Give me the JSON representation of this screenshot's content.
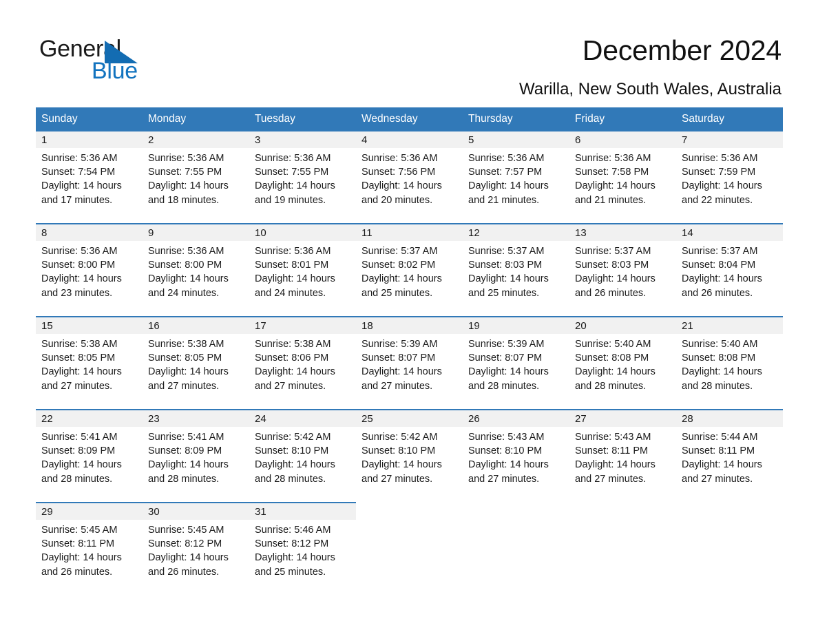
{
  "brand": {
    "word_one": "General",
    "word_two": "Blue",
    "triangle_icon": "triangle-icon",
    "accent_color": "#1273bf",
    "header_color": "#3179b8"
  },
  "header": {
    "title": "December 2024",
    "location": "Warilla, New South Wales, Australia"
  },
  "calendar": {
    "weekdays": [
      "Sunday",
      "Monday",
      "Tuesday",
      "Wednesday",
      "Thursday",
      "Friday",
      "Saturday"
    ],
    "weeks": [
      [
        {
          "day": "1",
          "sunrise": "Sunrise: 5:36 AM",
          "sunset": "Sunset: 7:54 PM",
          "daylight_1": "Daylight: 14 hours",
          "daylight_2": "and 17 minutes."
        },
        {
          "day": "2",
          "sunrise": "Sunrise: 5:36 AM",
          "sunset": "Sunset: 7:55 PM",
          "daylight_1": "Daylight: 14 hours",
          "daylight_2": "and 18 minutes."
        },
        {
          "day": "3",
          "sunrise": "Sunrise: 5:36 AM",
          "sunset": "Sunset: 7:55 PM",
          "daylight_1": "Daylight: 14 hours",
          "daylight_2": "and 19 minutes."
        },
        {
          "day": "4",
          "sunrise": "Sunrise: 5:36 AM",
          "sunset": "Sunset: 7:56 PM",
          "daylight_1": "Daylight: 14 hours",
          "daylight_2": "and 20 minutes."
        },
        {
          "day": "5",
          "sunrise": "Sunrise: 5:36 AM",
          "sunset": "Sunset: 7:57 PM",
          "daylight_1": "Daylight: 14 hours",
          "daylight_2": "and 21 minutes."
        },
        {
          "day": "6",
          "sunrise": "Sunrise: 5:36 AM",
          "sunset": "Sunset: 7:58 PM",
          "daylight_1": "Daylight: 14 hours",
          "daylight_2": "and 21 minutes."
        },
        {
          "day": "7",
          "sunrise": "Sunrise: 5:36 AM",
          "sunset": "Sunset: 7:59 PM",
          "daylight_1": "Daylight: 14 hours",
          "daylight_2": "and 22 minutes."
        }
      ],
      [
        {
          "day": "8",
          "sunrise": "Sunrise: 5:36 AM",
          "sunset": "Sunset: 8:00 PM",
          "daylight_1": "Daylight: 14 hours",
          "daylight_2": "and 23 minutes."
        },
        {
          "day": "9",
          "sunrise": "Sunrise: 5:36 AM",
          "sunset": "Sunset: 8:00 PM",
          "daylight_1": "Daylight: 14 hours",
          "daylight_2": "and 24 minutes."
        },
        {
          "day": "10",
          "sunrise": "Sunrise: 5:36 AM",
          "sunset": "Sunset: 8:01 PM",
          "daylight_1": "Daylight: 14 hours",
          "daylight_2": "and 24 minutes."
        },
        {
          "day": "11",
          "sunrise": "Sunrise: 5:37 AM",
          "sunset": "Sunset: 8:02 PM",
          "daylight_1": "Daylight: 14 hours",
          "daylight_2": "and 25 minutes."
        },
        {
          "day": "12",
          "sunrise": "Sunrise: 5:37 AM",
          "sunset": "Sunset: 8:03 PM",
          "daylight_1": "Daylight: 14 hours",
          "daylight_2": "and 25 minutes."
        },
        {
          "day": "13",
          "sunrise": "Sunrise: 5:37 AM",
          "sunset": "Sunset: 8:03 PM",
          "daylight_1": "Daylight: 14 hours",
          "daylight_2": "and 26 minutes."
        },
        {
          "day": "14",
          "sunrise": "Sunrise: 5:37 AM",
          "sunset": "Sunset: 8:04 PM",
          "daylight_1": "Daylight: 14 hours",
          "daylight_2": "and 26 minutes."
        }
      ],
      [
        {
          "day": "15",
          "sunrise": "Sunrise: 5:38 AM",
          "sunset": "Sunset: 8:05 PM",
          "daylight_1": "Daylight: 14 hours",
          "daylight_2": "and 27 minutes."
        },
        {
          "day": "16",
          "sunrise": "Sunrise: 5:38 AM",
          "sunset": "Sunset: 8:05 PM",
          "daylight_1": "Daylight: 14 hours",
          "daylight_2": "and 27 minutes."
        },
        {
          "day": "17",
          "sunrise": "Sunrise: 5:38 AM",
          "sunset": "Sunset: 8:06 PM",
          "daylight_1": "Daylight: 14 hours",
          "daylight_2": "and 27 minutes."
        },
        {
          "day": "18",
          "sunrise": "Sunrise: 5:39 AM",
          "sunset": "Sunset: 8:07 PM",
          "daylight_1": "Daylight: 14 hours",
          "daylight_2": "and 27 minutes."
        },
        {
          "day": "19",
          "sunrise": "Sunrise: 5:39 AM",
          "sunset": "Sunset: 8:07 PM",
          "daylight_1": "Daylight: 14 hours",
          "daylight_2": "and 28 minutes."
        },
        {
          "day": "20",
          "sunrise": "Sunrise: 5:40 AM",
          "sunset": "Sunset: 8:08 PM",
          "daylight_1": "Daylight: 14 hours",
          "daylight_2": "and 28 minutes."
        },
        {
          "day": "21",
          "sunrise": "Sunrise: 5:40 AM",
          "sunset": "Sunset: 8:08 PM",
          "daylight_1": "Daylight: 14 hours",
          "daylight_2": "and 28 minutes."
        }
      ],
      [
        {
          "day": "22",
          "sunrise": "Sunrise: 5:41 AM",
          "sunset": "Sunset: 8:09 PM",
          "daylight_1": "Daylight: 14 hours",
          "daylight_2": "and 28 minutes."
        },
        {
          "day": "23",
          "sunrise": "Sunrise: 5:41 AM",
          "sunset": "Sunset: 8:09 PM",
          "daylight_1": "Daylight: 14 hours",
          "daylight_2": "and 28 minutes."
        },
        {
          "day": "24",
          "sunrise": "Sunrise: 5:42 AM",
          "sunset": "Sunset: 8:10 PM",
          "daylight_1": "Daylight: 14 hours",
          "daylight_2": "and 28 minutes."
        },
        {
          "day": "25",
          "sunrise": "Sunrise: 5:42 AM",
          "sunset": "Sunset: 8:10 PM",
          "daylight_1": "Daylight: 14 hours",
          "daylight_2": "and 27 minutes."
        },
        {
          "day": "26",
          "sunrise": "Sunrise: 5:43 AM",
          "sunset": "Sunset: 8:10 PM",
          "daylight_1": "Daylight: 14 hours",
          "daylight_2": "and 27 minutes."
        },
        {
          "day": "27",
          "sunrise": "Sunrise: 5:43 AM",
          "sunset": "Sunset: 8:11 PM",
          "daylight_1": "Daylight: 14 hours",
          "daylight_2": "and 27 minutes."
        },
        {
          "day": "28",
          "sunrise": "Sunrise: 5:44 AM",
          "sunset": "Sunset: 8:11 PM",
          "daylight_1": "Daylight: 14 hours",
          "daylight_2": "and 27 minutes."
        }
      ],
      [
        {
          "day": "29",
          "sunrise": "Sunrise: 5:45 AM",
          "sunset": "Sunset: 8:11 PM",
          "daylight_1": "Daylight: 14 hours",
          "daylight_2": "and 26 minutes."
        },
        {
          "day": "30",
          "sunrise": "Sunrise: 5:45 AM",
          "sunset": "Sunset: 8:12 PM",
          "daylight_1": "Daylight: 14 hours",
          "daylight_2": "and 26 minutes."
        },
        {
          "day": "31",
          "sunrise": "Sunrise: 5:46 AM",
          "sunset": "Sunset: 8:12 PM",
          "daylight_1": "Daylight: 14 hours",
          "daylight_2": "and 25 minutes."
        },
        {
          "day": "",
          "sunrise": "",
          "sunset": "",
          "daylight_1": "",
          "daylight_2": ""
        },
        {
          "day": "",
          "sunrise": "",
          "sunset": "",
          "daylight_1": "",
          "daylight_2": ""
        },
        {
          "day": "",
          "sunrise": "",
          "sunset": "",
          "daylight_1": "",
          "daylight_2": ""
        },
        {
          "day": "",
          "sunrise": "",
          "sunset": "",
          "daylight_1": "",
          "daylight_2": ""
        }
      ]
    ]
  }
}
